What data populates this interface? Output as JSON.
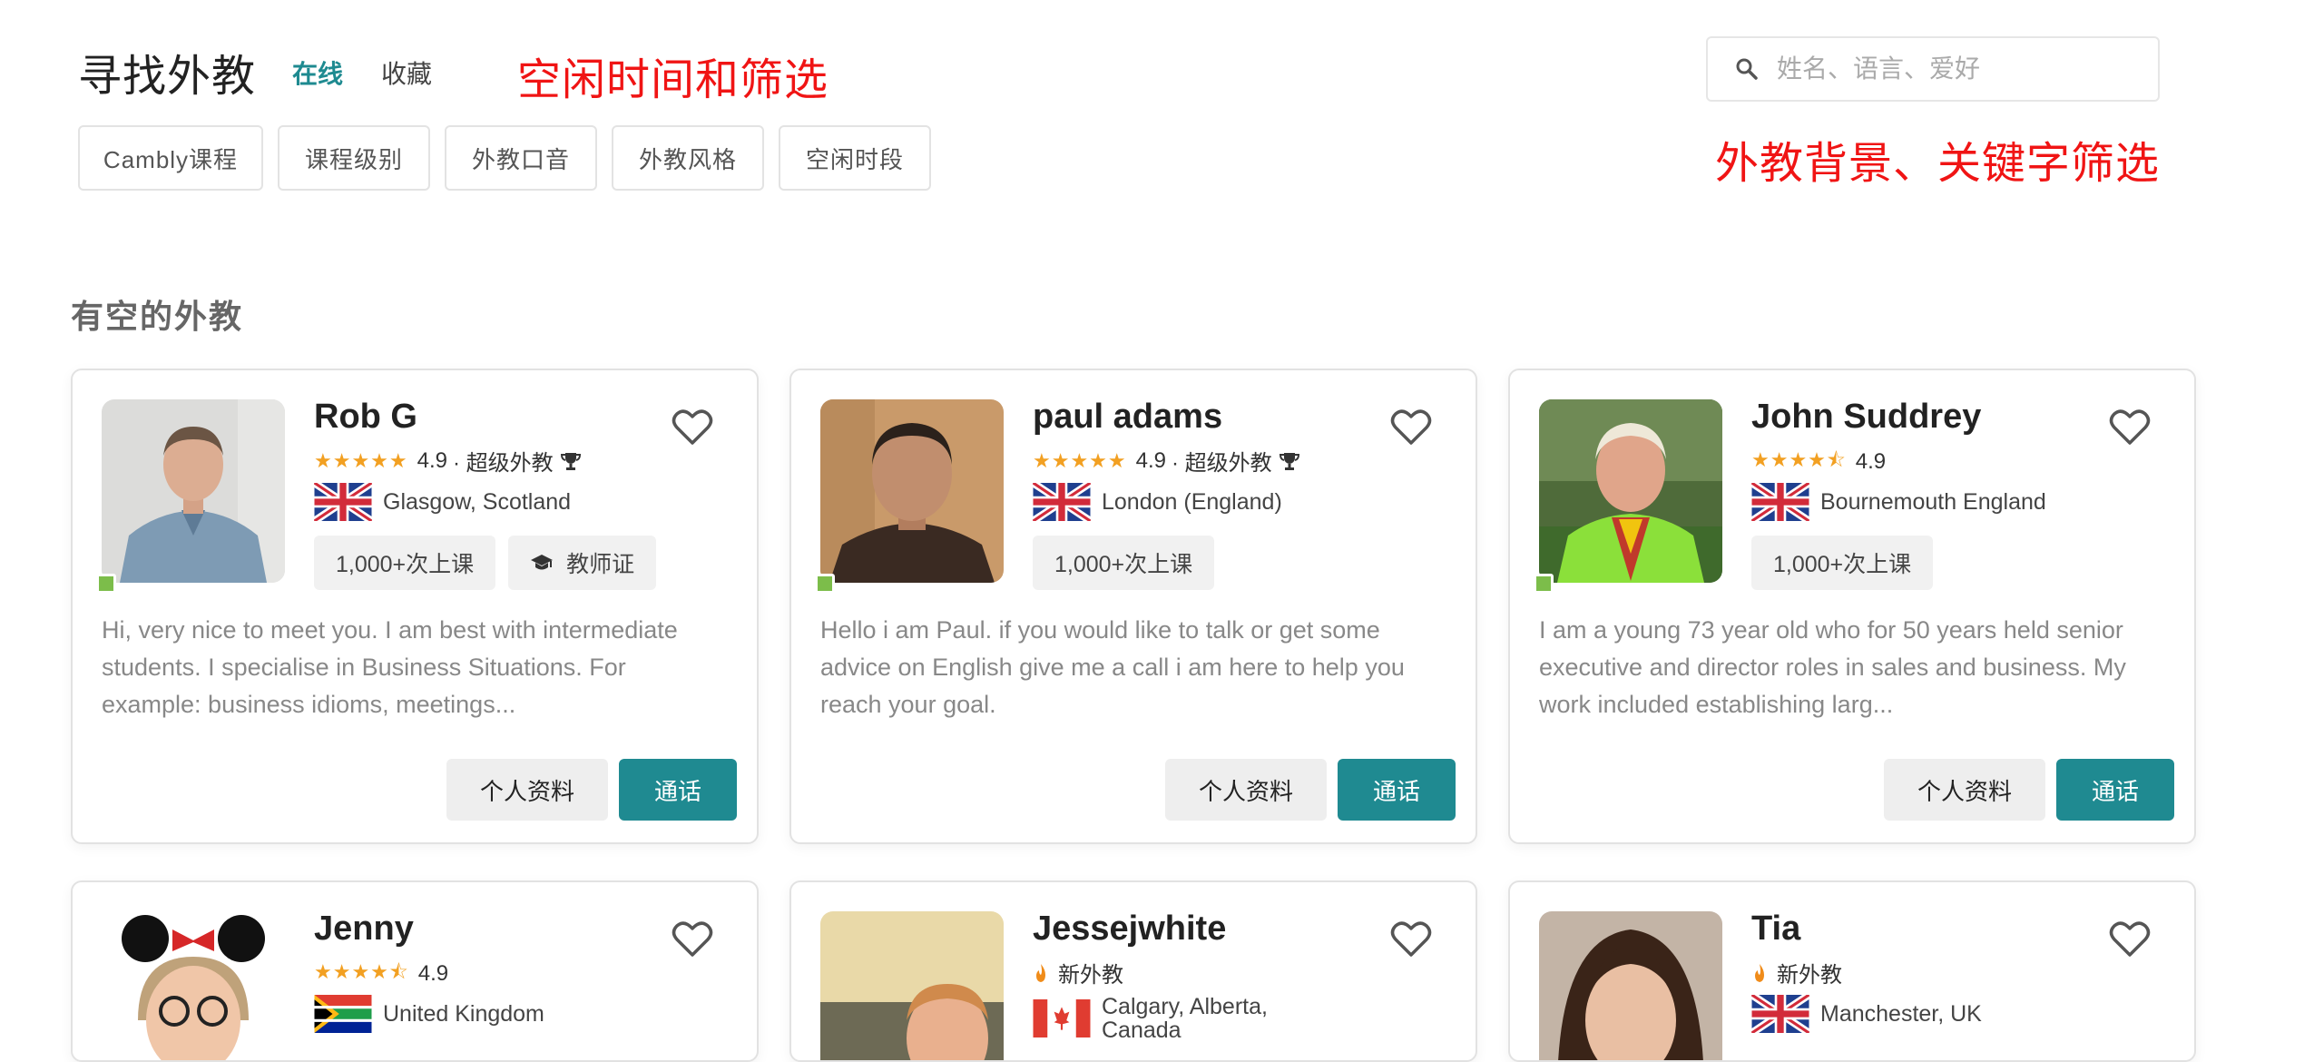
{
  "header": {
    "title": "寻找外教",
    "tabs": [
      {
        "label": "在线",
        "active": true
      },
      {
        "label": "收藏",
        "active": false
      }
    ],
    "annotation_time": "空闲时间和筛选",
    "annotation_keyword": "外教背景、关键字筛选",
    "annotation_color": "#f01414",
    "search": {
      "placeholder": "姓名、语言、爱好",
      "value": "",
      "icon": "search-icon"
    }
  },
  "filters": [
    "Cambly课程",
    "课程级别",
    "外教口音",
    "外教风格",
    "空闲时段"
  ],
  "section_title": "有空的外教",
  "accent_color": "#1f8a91",
  "star_color": "#f2a022",
  "tutors": [
    {
      "name": "Rob G",
      "stars": "★★★★★",
      "rating": "4.9",
      "super_label": "· 超级外教",
      "location": "Glasgow, Scotland",
      "flag": "uk-flag",
      "badges": [
        "1,000+次上课",
        "教师证"
      ],
      "bio": "Hi, very nice to meet you. I am best with intermediate students. I specialise in Business Situations. For example: business idioms, meetings...",
      "profile_label": "个人资料",
      "call_label": "通话",
      "online": true
    },
    {
      "name": "paul adams",
      "stars": "★★★★★",
      "rating": "4.9",
      "super_label": "· 超级外教",
      "location": "London (England)",
      "flag": "uk-flag",
      "badges": [
        "1,000+次上课"
      ],
      "bio": "Hello i am Paul. if you would like to talk or get some advice on English give me a call i am here to help you reach your goal.",
      "profile_label": "个人资料",
      "call_label": "通话",
      "online": true
    },
    {
      "name": "John Suddrey",
      "stars": "★★★★⯪",
      "rating": "4.9",
      "location": "Bournemouth England",
      "flag": "uk-flag",
      "badges": [
        "1,000+次上课"
      ],
      "bio": "I am a young 73 year old who for 50 years held senior executive and director roles in sales and business. My work included establishing larg...",
      "profile_label": "个人资料",
      "call_label": "通话",
      "online": true
    },
    {
      "name": "Jenny",
      "stars": "★★★★⯪",
      "rating": "4.9",
      "location": "United Kingdom",
      "flag": "south-africa-flag"
    },
    {
      "name": "Jessejwhite",
      "new_label": "新外教",
      "location_line1": "Calgary, Alberta,",
      "location_line2": "Canada",
      "flag": "canada-flag"
    },
    {
      "name": "Tia",
      "new_label": "新外教",
      "location": "Manchester, UK",
      "flag": "uk-flag"
    }
  ]
}
